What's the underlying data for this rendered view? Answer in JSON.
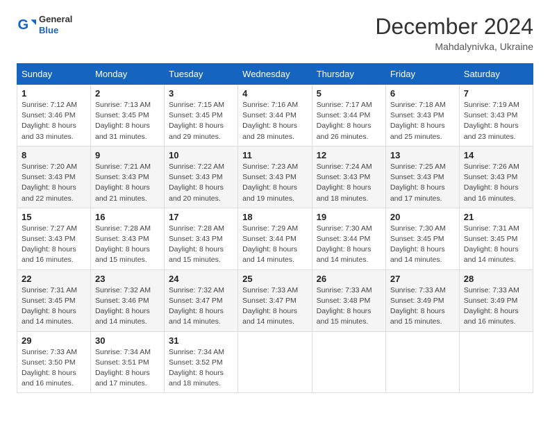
{
  "logo": {
    "general": "General",
    "blue": "Blue"
  },
  "title": "December 2024",
  "location": "Mahdalynivka, Ukraine",
  "days_header": [
    "Sunday",
    "Monday",
    "Tuesday",
    "Wednesday",
    "Thursday",
    "Friday",
    "Saturday"
  ],
  "weeks": [
    [
      {
        "day": "1",
        "info": "Sunrise: 7:12 AM\nSunset: 3:46 PM\nDaylight: 8 hours\nand 33 minutes."
      },
      {
        "day": "2",
        "info": "Sunrise: 7:13 AM\nSunset: 3:45 PM\nDaylight: 8 hours\nand 31 minutes."
      },
      {
        "day": "3",
        "info": "Sunrise: 7:15 AM\nSunset: 3:45 PM\nDaylight: 8 hours\nand 29 minutes."
      },
      {
        "day": "4",
        "info": "Sunrise: 7:16 AM\nSunset: 3:44 PM\nDaylight: 8 hours\nand 28 minutes."
      },
      {
        "day": "5",
        "info": "Sunrise: 7:17 AM\nSunset: 3:44 PM\nDaylight: 8 hours\nand 26 minutes."
      },
      {
        "day": "6",
        "info": "Sunrise: 7:18 AM\nSunset: 3:43 PM\nDaylight: 8 hours\nand 25 minutes."
      },
      {
        "day": "7",
        "info": "Sunrise: 7:19 AM\nSunset: 3:43 PM\nDaylight: 8 hours\nand 23 minutes."
      }
    ],
    [
      {
        "day": "8",
        "info": "Sunrise: 7:20 AM\nSunset: 3:43 PM\nDaylight: 8 hours\nand 22 minutes."
      },
      {
        "day": "9",
        "info": "Sunrise: 7:21 AM\nSunset: 3:43 PM\nDaylight: 8 hours\nand 21 minutes."
      },
      {
        "day": "10",
        "info": "Sunrise: 7:22 AM\nSunset: 3:43 PM\nDaylight: 8 hours\nand 20 minutes."
      },
      {
        "day": "11",
        "info": "Sunrise: 7:23 AM\nSunset: 3:43 PM\nDaylight: 8 hours\nand 19 minutes."
      },
      {
        "day": "12",
        "info": "Sunrise: 7:24 AM\nSunset: 3:43 PM\nDaylight: 8 hours\nand 18 minutes."
      },
      {
        "day": "13",
        "info": "Sunrise: 7:25 AM\nSunset: 3:43 PM\nDaylight: 8 hours\nand 17 minutes."
      },
      {
        "day": "14",
        "info": "Sunrise: 7:26 AM\nSunset: 3:43 PM\nDaylight: 8 hours\nand 16 minutes."
      }
    ],
    [
      {
        "day": "15",
        "info": "Sunrise: 7:27 AM\nSunset: 3:43 PM\nDaylight: 8 hours\nand 16 minutes."
      },
      {
        "day": "16",
        "info": "Sunrise: 7:28 AM\nSunset: 3:43 PM\nDaylight: 8 hours\nand 15 minutes."
      },
      {
        "day": "17",
        "info": "Sunrise: 7:28 AM\nSunset: 3:43 PM\nDaylight: 8 hours\nand 15 minutes."
      },
      {
        "day": "18",
        "info": "Sunrise: 7:29 AM\nSunset: 3:44 PM\nDaylight: 8 hours\nand 14 minutes."
      },
      {
        "day": "19",
        "info": "Sunrise: 7:30 AM\nSunset: 3:44 PM\nDaylight: 8 hours\nand 14 minutes."
      },
      {
        "day": "20",
        "info": "Sunrise: 7:30 AM\nSunset: 3:45 PM\nDaylight: 8 hours\nand 14 minutes."
      },
      {
        "day": "21",
        "info": "Sunrise: 7:31 AM\nSunset: 3:45 PM\nDaylight: 8 hours\nand 14 minutes."
      }
    ],
    [
      {
        "day": "22",
        "info": "Sunrise: 7:31 AM\nSunset: 3:45 PM\nDaylight: 8 hours\nand 14 minutes."
      },
      {
        "day": "23",
        "info": "Sunrise: 7:32 AM\nSunset: 3:46 PM\nDaylight: 8 hours\nand 14 minutes."
      },
      {
        "day": "24",
        "info": "Sunrise: 7:32 AM\nSunset: 3:47 PM\nDaylight: 8 hours\nand 14 minutes."
      },
      {
        "day": "25",
        "info": "Sunrise: 7:33 AM\nSunset: 3:47 PM\nDaylight: 8 hours\nand 14 minutes."
      },
      {
        "day": "26",
        "info": "Sunrise: 7:33 AM\nSunset: 3:48 PM\nDaylight: 8 hours\nand 15 minutes."
      },
      {
        "day": "27",
        "info": "Sunrise: 7:33 AM\nSunset: 3:49 PM\nDaylight: 8 hours\nand 15 minutes."
      },
      {
        "day": "28",
        "info": "Sunrise: 7:33 AM\nSunset: 3:49 PM\nDaylight: 8 hours\nand 16 minutes."
      }
    ],
    [
      {
        "day": "29",
        "info": "Sunrise: 7:33 AM\nSunset: 3:50 PM\nDaylight: 8 hours\nand 16 minutes."
      },
      {
        "day": "30",
        "info": "Sunrise: 7:34 AM\nSunset: 3:51 PM\nDaylight: 8 hours\nand 17 minutes."
      },
      {
        "day": "31",
        "info": "Sunrise: 7:34 AM\nSunset: 3:52 PM\nDaylight: 8 hours\nand 18 minutes."
      },
      null,
      null,
      null,
      null
    ]
  ]
}
